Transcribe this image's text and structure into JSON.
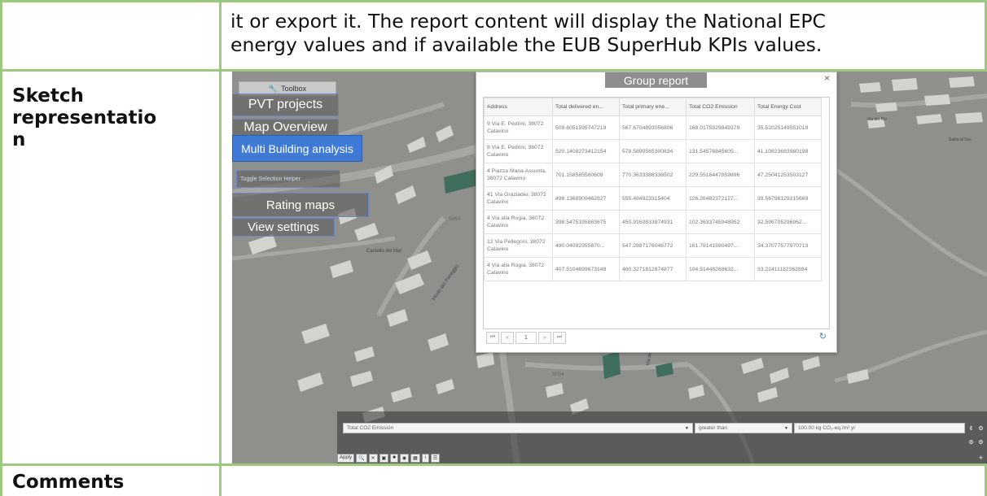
{
  "document": {
    "intro_lines": [
      "it or export it. The report content will display the National EPC",
      "energy values and if available the EUB SuperHub KPIs values."
    ],
    "sketch_label_lines": [
      "Sketch",
      "representatio",
      "n"
    ],
    "comments_label": "Comments",
    "border_color": "#9cc97f"
  },
  "app": {
    "toolbox_label": "Toolbox",
    "menu": {
      "pvt_projects": "PVT projects",
      "map_overview": "Map Overview",
      "multi_building": "Multi  Building analysis",
      "toggle_selection": "Toggle Selection Helper",
      "rating_maps": "Rating maps",
      "view_settings": "View settings"
    },
    "map_labels": {
      "sp94_a": "SP94",
      "sp94_b": "SP94",
      "castello": "Castello dei Mar",
      "vicolo": "Vicolo del Paneggio",
      "via_fu": "Via dei Fu",
      "strada": "Strada del Sole",
      "via_loreto": "Via del Rio",
      "salita": "Salita al Sas"
    },
    "report": {
      "title": "Group report",
      "close": "×",
      "columns": [
        "Address",
        "Total delivered en...",
        "Total primary ene...",
        "Total CO2 Emission",
        "Total Energy Cost"
      ],
      "rows": [
        [
          "9 Via E. Pedrini, 38072 Calavino",
          "509.6051595747219",
          "567.6704893056806",
          "168.0175929849379",
          "35.52025149551019"
        ],
        [
          "8 Via E. Pedrini, 38072 Calavino",
          "520.1408273412154",
          "578.5890565300834",
          "131.54576845605...",
          "41.10823683980198"
        ],
        [
          "4 Piazza Maria Assunta, 38072 Calavino",
          "701.158585580609",
          "770.3633386336502",
          "229.5516447859896",
          "47.25041253503127"
        ],
        [
          "41 Via Graziadei, 38072 Calavino",
          "498.1368909462827",
          "555.484923315404",
          "126.26482372127...",
          "39.56796129215669"
        ],
        [
          "4 Via alla Rogia, 38072 Calavino",
          "398.5475195863675",
          "450.9160833874931",
          "102.3633745948952",
          "32.596705296962..."
        ],
        [
          "12 Via Pellegrini, 38072 Calavino",
          "490.04092355870...",
          "547.2887176046772",
          "161.78141590497...",
          "34.37077577970713"
        ],
        [
          "4 Via alla Rogia, 38072 Calavino",
          "407.5104699673148",
          "460.3271812874877",
          "104.51448268632...",
          "33.22411182362894"
        ]
      ],
      "pager": {
        "first": "⏮",
        "prev": "«",
        "page": "1",
        "next": "»",
        "last": "⏭"
      },
      "refresh_icon": "refresh-icon"
    },
    "filter": {
      "attribute": "Total CO2 Emission",
      "operator": "greater than",
      "value": "100.00 kg CO₂-eq./m² yr"
    },
    "bottom_bar": {
      "apply": "Apply",
      "add": "+"
    }
  }
}
